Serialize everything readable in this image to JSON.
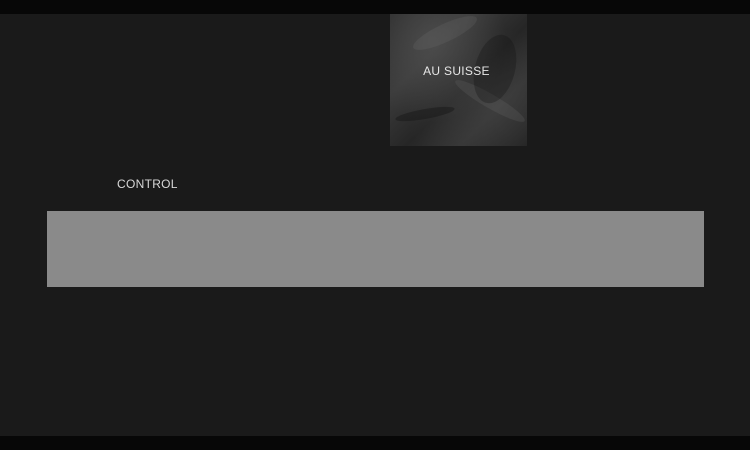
{
  "album": {
    "title": "AU SUISSE"
  },
  "section": {
    "label": "CONTROL"
  },
  "colors": {
    "background": "#1a1a1a",
    "letterbox": "#070707",
    "control_bar": "#8a8a8a",
    "text": "#e6e6e6"
  }
}
